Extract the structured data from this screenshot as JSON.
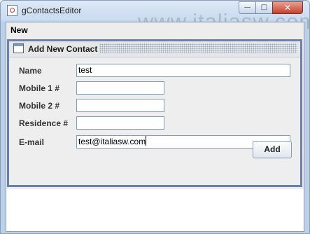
{
  "window": {
    "title": "gContactsEditor",
    "icon": "app-icon",
    "watermark": "www.italiasw.com",
    "controls": {
      "minimize": "minimize-icon",
      "maximize": "maximize-icon",
      "close": "close-icon"
    }
  },
  "menubar": {
    "items": [
      {
        "label": "New"
      }
    ]
  },
  "internal_frame": {
    "title": "Add New Contact",
    "icon": "frame-icon",
    "form": {
      "fields": [
        {
          "label": "Name",
          "value": "test"
        },
        {
          "label": "Mobile 1 #",
          "value": ""
        },
        {
          "label": "Mobile 2 #",
          "value": ""
        },
        {
          "label": "Residence #",
          "value": ""
        },
        {
          "label": "E-mail",
          "value": "test@italiasw.com"
        }
      ],
      "submit_label": "Add"
    }
  },
  "colors": {
    "frame_border": "#6a80b0",
    "titlebar": "#c9dbef",
    "close_button": "#c6412e"
  }
}
